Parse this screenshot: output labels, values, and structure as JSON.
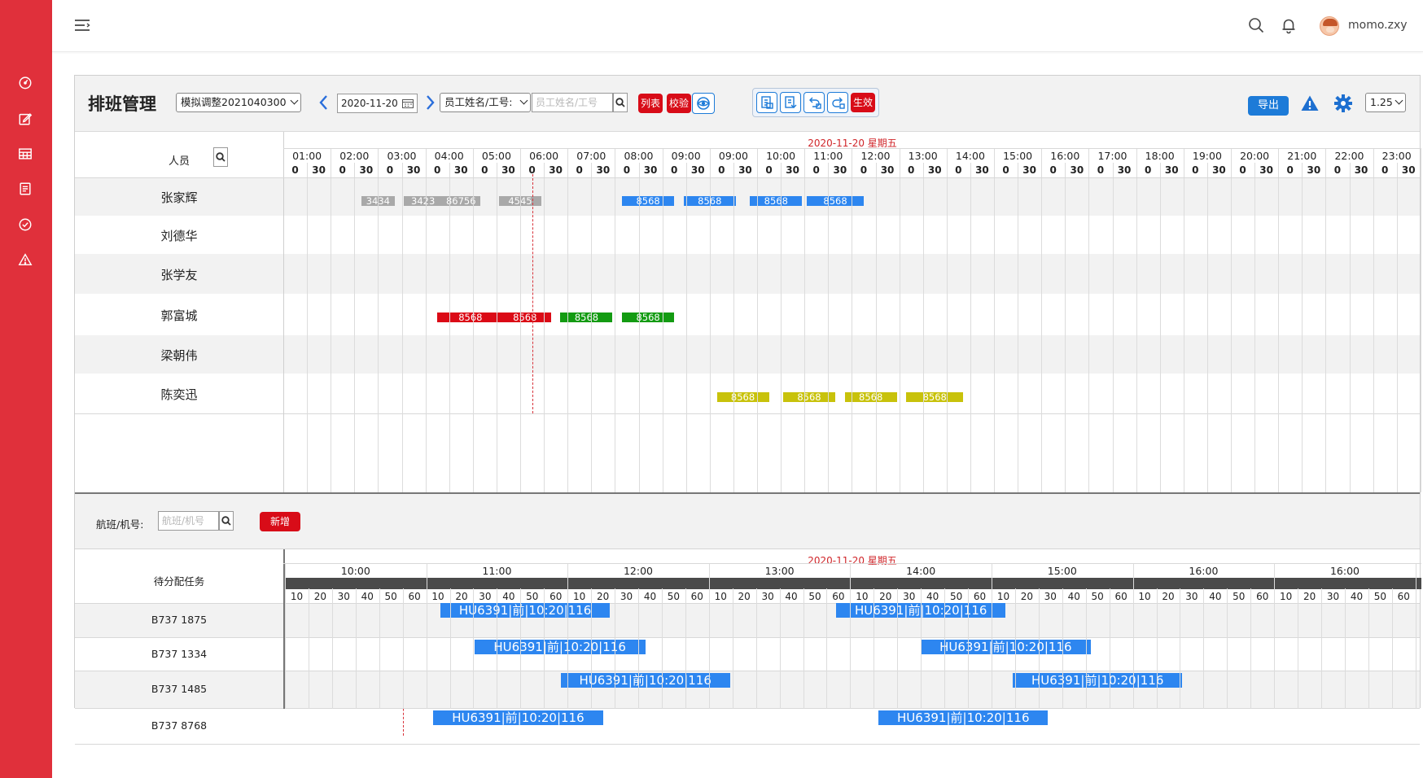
{
  "header": {
    "username": "momo.zxy"
  },
  "toolbar": {
    "title": "排班管理",
    "plan_select": "模拟调整2021040300",
    "date": "2020-11-20",
    "filter_select": "员工姓名/工号:",
    "filter_placeholder": "员工姓名/工号",
    "list_btn": "列表",
    "check_btn": "校验",
    "effect_btn": "生效",
    "export_btn": "导出",
    "zoom_select": "1.25"
  },
  "staff_grid": {
    "date_label": "2020-11-20 星期五",
    "person_header": "人员",
    "hours": [
      "01:00",
      "02:00",
      "03:00",
      "04:00",
      "05:00",
      "06:00",
      "07:00",
      "08:00",
      "09:00",
      "09:00",
      "10:00",
      "11:00",
      "12:00",
      "13:00",
      "14:00",
      "15:00",
      "16:00",
      "17:00",
      "18:00",
      "19:00",
      "20:00",
      "21:00",
      "22:00",
      "23:00"
    ],
    "half_labels": [
      "0",
      "30"
    ],
    "rows": [
      {
        "name": "张家辉",
        "bars": [
          {
            "label": "3434",
            "color": "gray",
            "start": 2.5,
            "end": 3.2
          },
          {
            "label": "3423",
            "color": "gray",
            "start": 3.4,
            "end": 4.2
          },
          {
            "label": "86756",
            "color": "gray",
            "start": 4.2,
            "end": 5.0
          },
          {
            "label": "4545",
            "color": "gray",
            "start": 5.4,
            "end": 6.3
          },
          {
            "label": "8568",
            "color": "blue",
            "start": 8.0,
            "end": 9.1
          },
          {
            "label": "8568",
            "color": "blue",
            "start": 9.3,
            "end": 10.4
          },
          {
            "label": "8568",
            "color": "blue",
            "start": 10.7,
            "end": 11.8
          },
          {
            "label": "8568",
            "color": "blue",
            "start": 11.9,
            "end": 13.1
          }
        ]
      },
      {
        "name": "刘德华",
        "bars": []
      },
      {
        "name": "张学友",
        "bars": []
      },
      {
        "name": "郭富城",
        "bars": [
          {
            "label": "8568",
            "color": "red",
            "start": 4.1,
            "end": 5.5
          },
          {
            "label": "8568",
            "color": "red",
            "start": 5.4,
            "end": 6.5
          },
          {
            "label": "8568",
            "color": "green",
            "start": 6.7,
            "end": 7.8
          },
          {
            "label": "8568",
            "color": "green",
            "start": 8.0,
            "end": 9.1
          }
        ]
      },
      {
        "name": "梁朝伟",
        "bars": []
      },
      {
        "name": "陈奕迅",
        "bars": [
          {
            "label": "8568",
            "color": "olive",
            "start": 10.0,
            "end": 11.1
          },
          {
            "label": "8568",
            "color": "olive",
            "start": 11.4,
            "end": 12.5
          },
          {
            "label": "8568",
            "color": "olive",
            "start": 12.7,
            "end": 13.8
          },
          {
            "label": "8568",
            "color": "olive",
            "start": 14.0,
            "end": 15.2
          }
        ]
      }
    ]
  },
  "flight_panel": {
    "flight_label": "航班/机号:",
    "flight_placeholder": "航班/机号",
    "add_btn": "新增",
    "date_label": "2020-11-20 星期五",
    "pending_header": "待分配任务",
    "hours": [
      "10:00",
      "11:00",
      "12:00",
      "13:00",
      "14:00",
      "15:00",
      "16:00",
      "16:00"
    ],
    "minute_labels": [
      "10",
      "20",
      "30",
      "40",
      "50",
      "60"
    ],
    "rows": [
      {
        "plane": "B737   1875",
        "bars": [
          {
            "label": "HU6391|前|10:20|116",
            "start": 1.1,
            "end": 2.3
          },
          {
            "label": "HU6391|前|10:20|116",
            "start": 3.9,
            "end": 5.1
          }
        ]
      },
      {
        "plane": "B737   1334",
        "bars": [
          {
            "label": "HU6391|前|10:20|116",
            "start": 1.34,
            "end": 2.55
          },
          {
            "label": "HU6391|前|10:20|116",
            "start": 4.5,
            "end": 5.7
          }
        ]
      },
      {
        "plane": "B737  1485",
        "bars": [
          {
            "label": "HU6391|前|10:20|116",
            "start": 1.95,
            "end": 3.15
          },
          {
            "label": "HU6391|前|10:20|116",
            "start": 5.15,
            "end": 6.35
          }
        ]
      },
      {
        "plane": "B737  8768",
        "bars": [
          {
            "label": "HU6391|前|10:20|116",
            "start": 1.05,
            "end": 2.25
          },
          {
            "label": "HU6391|前|10:20|116",
            "start": 4.2,
            "end": 5.4
          }
        ]
      }
    ]
  }
}
